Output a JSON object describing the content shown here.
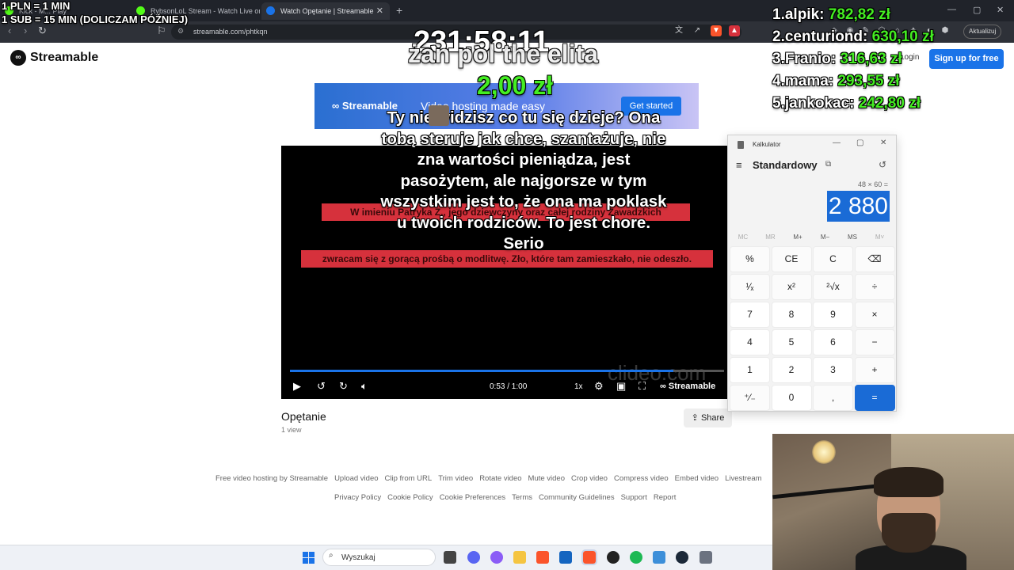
{
  "browser": {
    "tabs": [
      {
        "label": "Kick - M... Play"
      },
      {
        "label": "RybsonLoL Stream - Watch Live on K"
      },
      {
        "label": "Watch Opętanie | Streamable"
      }
    ],
    "url": "streamable.com/phtkqn",
    "update_label": "Aktualizuj"
  },
  "overlay": {
    "rule_pln": "1 PLN = 1 MIN",
    "rule_sub": "1 SUB = 15 MIN (DOLICZAM PÓŹNIEJ)",
    "timer": "231:58:11",
    "donation": {
      "name": "żan pol the elita",
      "amount": "2,00 zł",
      "message": "Ty nie widzisz co tu się dzieje? Ona tobą steruje jak chce, szantażuje, nie zna wartości pieniądza, jest pasożytem, ale najgorsze w tym wszystkim jest to, że ona ma poklask u twoich rodziców. To jest chore. Serio"
    },
    "leaderboard": [
      {
        "rank": "1.",
        "name": "alpik:",
        "amount": "782,82 zł"
      },
      {
        "rank": "2.",
        "name": "centuriond:",
        "amount": "630,10 zł"
      },
      {
        "rank": "3.",
        "name": "Franio:",
        "amount": "316,63 zł"
      },
      {
        "rank": "4.",
        "name": "mama:",
        "amount": "293,55 zł"
      },
      {
        "rank": "5.",
        "name": "jankokac:",
        "amount": "242,80 zł"
      }
    ]
  },
  "streamable": {
    "logo_text": "Streamable",
    "login_label": "Login",
    "signup_label": "Sign up for free",
    "banner": {
      "logo_text": "Streamable",
      "tagline": "Video hosting made easy",
      "cta": "Get started"
    },
    "player": {
      "caption_1": "W imieniu Patryka Z., jego dziewczyny oraz całej rodziny Zawadzkich",
      "caption_2": "zwracam się z gorącą prośbą o modlitwę. Zło, które tam zamieszkało, nie odeszło.",
      "watermark": "clideo.com",
      "time": "0:53 / 1:00",
      "progress": 0.883,
      "speed": "1x",
      "brand": "Streamable"
    },
    "video": {
      "title": "Opętanie",
      "views": "1 view",
      "share_label": "Share"
    },
    "footer": {
      "row1": [
        "Free video hosting by Streamable",
        "Upload video",
        "Clip from URL",
        "Trim video",
        "Rotate video",
        "Mute video",
        "Crop video",
        "Compress video",
        "Embed video",
        "Livestream"
      ],
      "row2": [
        "Privacy Policy",
        "Cookie Policy",
        "Cookie Preferences",
        "Terms",
        "Community Guidelines",
        "Support",
        "Report"
      ]
    }
  },
  "calculator": {
    "window_title": "Kalkulator",
    "mode": "Standardowy",
    "expression": "48 × 60 =",
    "display": "2 880",
    "memory": [
      "MC",
      "MR",
      "M+",
      "M−",
      "MS",
      "M˅"
    ],
    "keys": [
      [
        "%",
        "CE",
        "C",
        "⌫"
      ],
      [
        "¹⁄ₓ",
        "x²",
        "²√x",
        "÷"
      ],
      [
        "7",
        "8",
        "9",
        "×"
      ],
      [
        "4",
        "5",
        "6",
        "−"
      ],
      [
        "1",
        "2",
        "3",
        "+"
      ],
      [
        "⁺⁄₋",
        "0",
        ",",
        "="
      ]
    ]
  },
  "taskbar": {
    "search_placeholder": "Wyszukaj"
  },
  "colors": {
    "accent": "#1a73e8",
    "leaderboard_amount": "#44ee22",
    "caption_band": "#d6313c"
  }
}
